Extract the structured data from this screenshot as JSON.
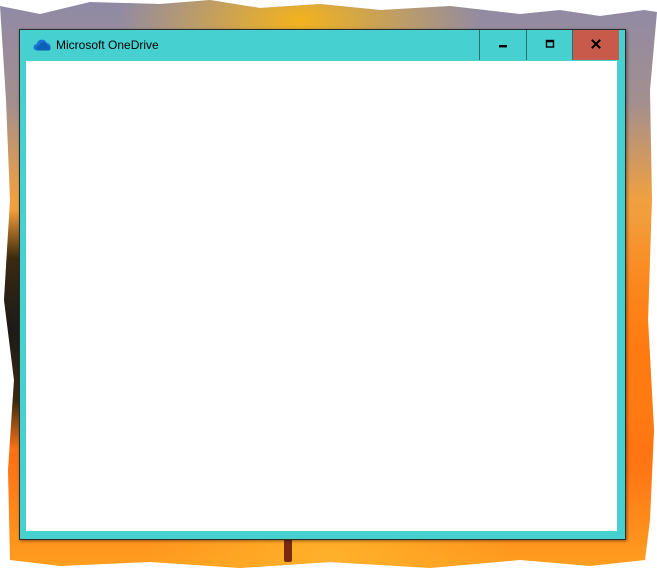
{
  "window": {
    "title": "Microsoft OneDrive",
    "app_icon": "onedrive-cloud-icon",
    "caption_buttons": {
      "minimize_icon": "minimize-icon",
      "maximize_icon": "maximize-icon",
      "close_icon": "close-icon"
    },
    "colors": {
      "frame": "#46d0d0",
      "close_button": "#c75a4b",
      "client_background": "#ffffff"
    }
  }
}
